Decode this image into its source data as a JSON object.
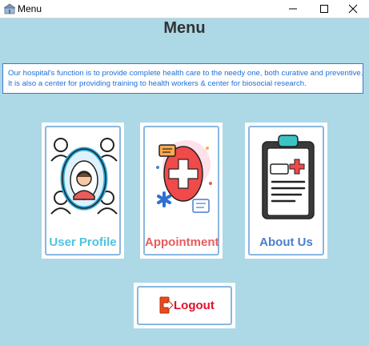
{
  "window": {
    "title": "Menu",
    "controls": [
      "minimize-icon",
      "maximize-icon",
      "close-icon"
    ]
  },
  "page": {
    "heading": "Menu",
    "description_line1": "Our hospital's function is to provide complete health care to the needy one, both curative and preventive.",
    "description_line2": "It is also a center for providing training to health workers & center for biosocial research."
  },
  "cards": [
    {
      "label": "User Profile",
      "icon": "user-network-icon",
      "color": "#4fc3e0"
    },
    {
      "label": "Appointment",
      "icon": "medical-cross-icon",
      "color": "#e85c5c"
    },
    {
      "label": "About Us",
      "icon": "clipboard-icon",
      "color": "#4a7ecb"
    }
  ],
  "logout": {
    "label": "Logout",
    "icon": "logout-icon",
    "color": "#e0102a"
  },
  "colors": {
    "background": "#add8e6",
    "description_text": "#1e6fd9",
    "description_border": "#3a7bd5"
  }
}
